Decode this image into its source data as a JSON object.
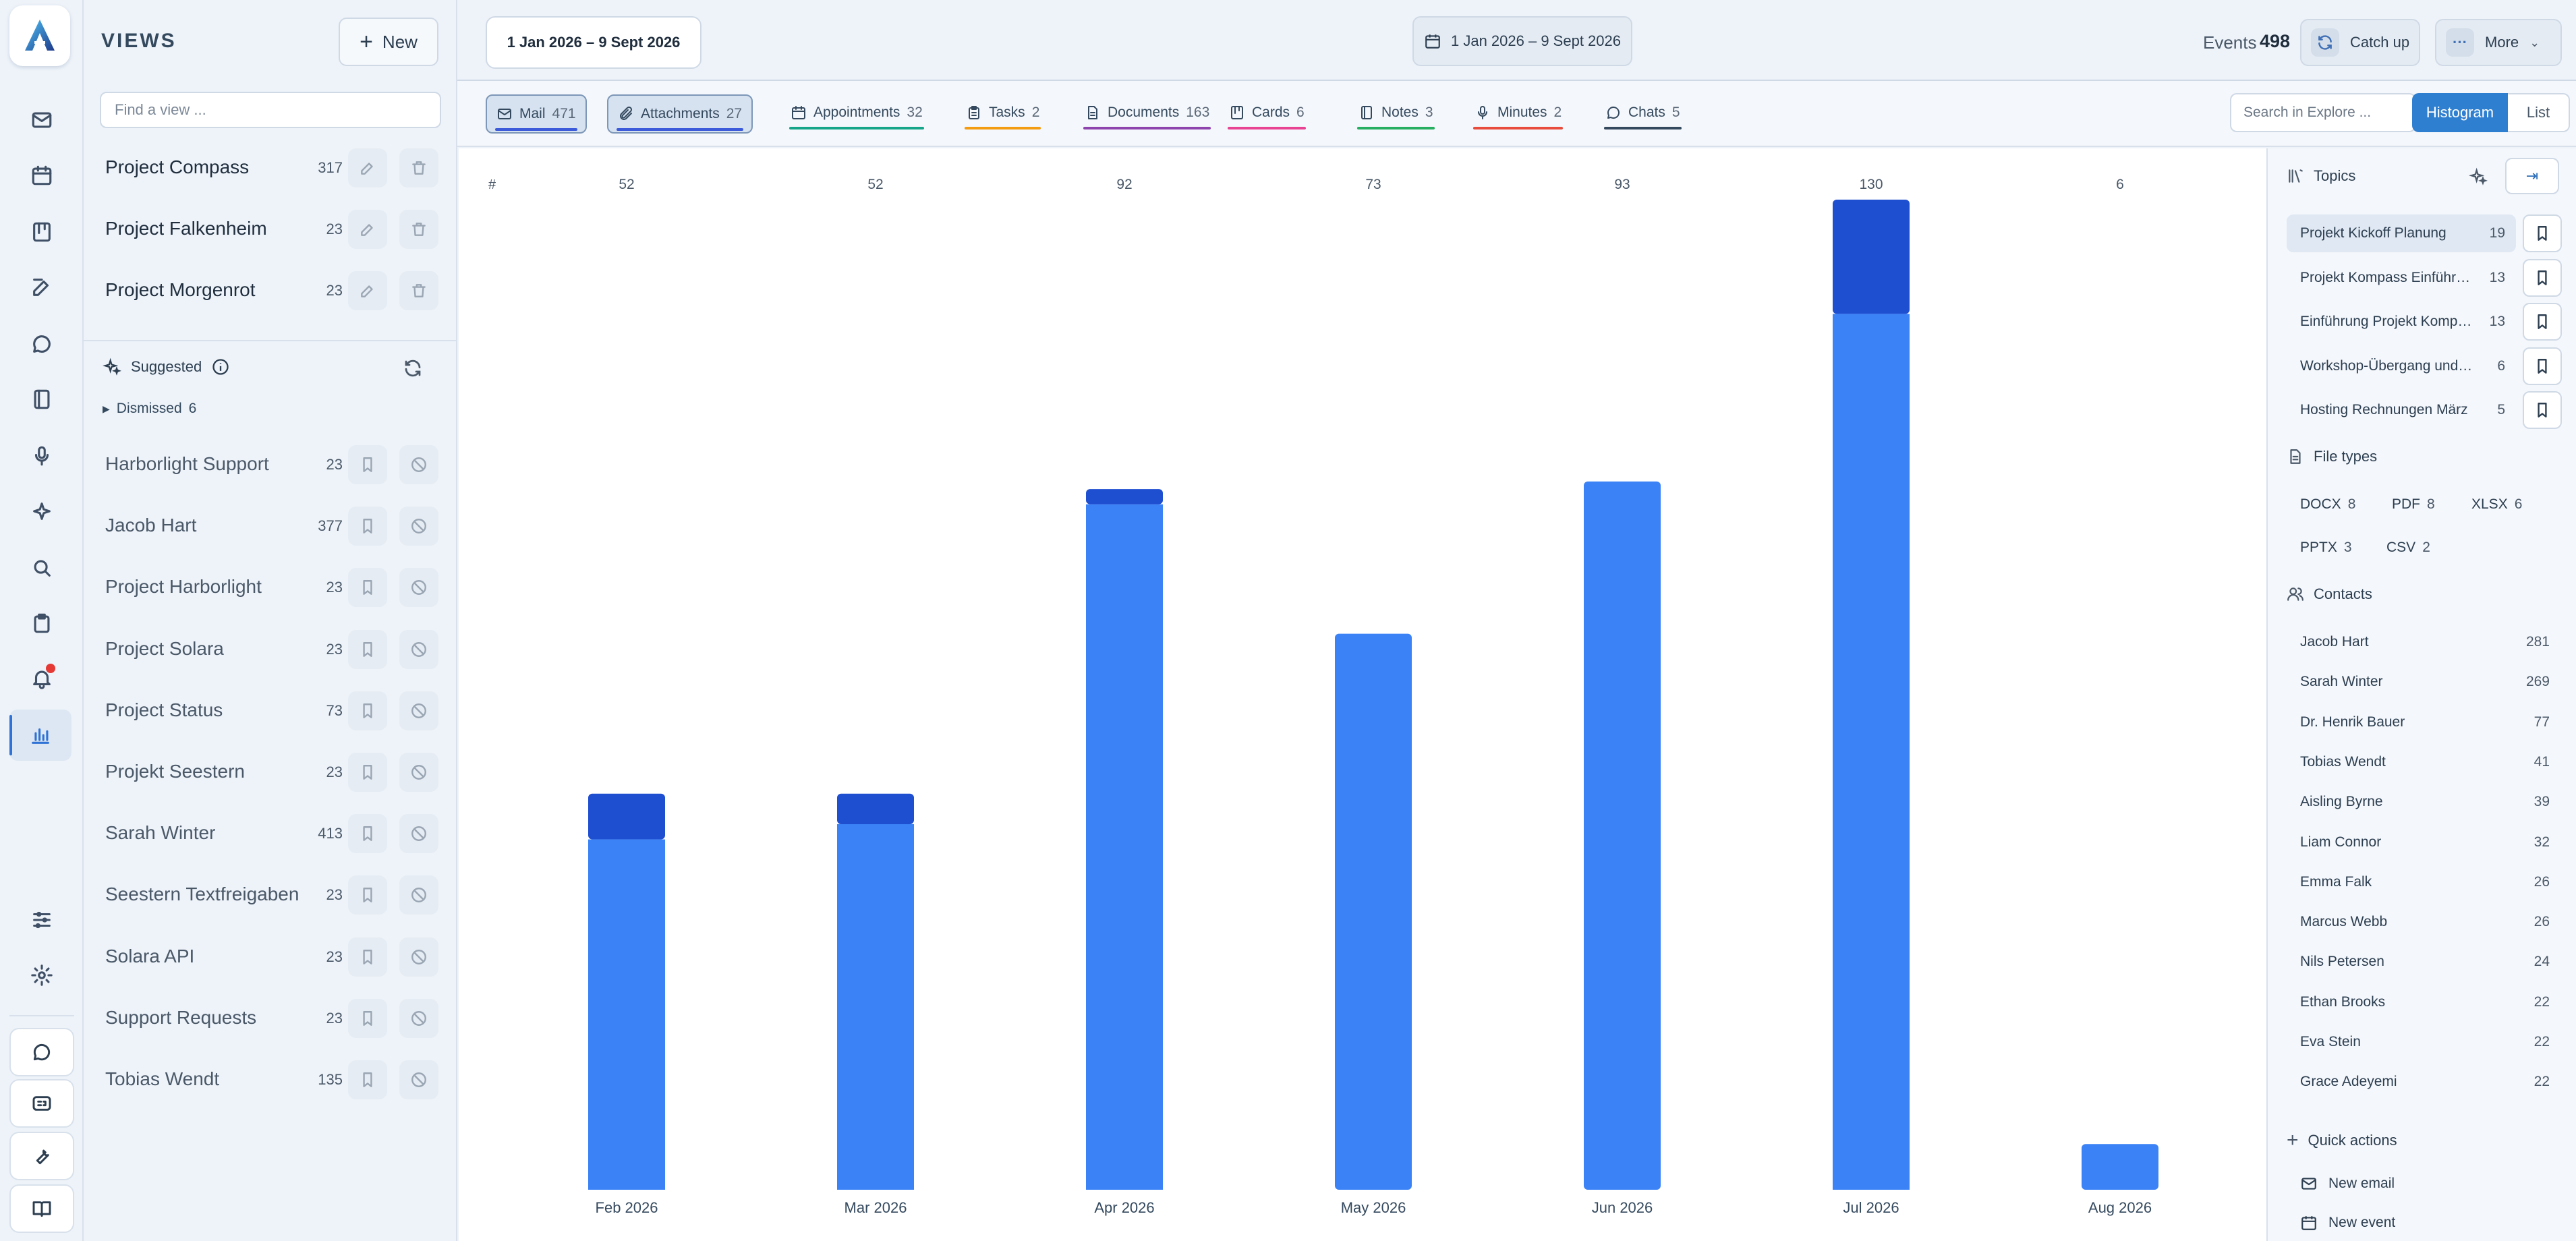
{
  "sidebar": {
    "title": "VIEWS",
    "new_label": "New",
    "find_placeholder": "Find a view ...",
    "views": [
      {
        "name": "Project Compass",
        "count": "317"
      },
      {
        "name": "Project Falkenheim",
        "count": "23"
      },
      {
        "name": "Project Morgenrot",
        "count": "23"
      }
    ],
    "suggested_label": "Suggested",
    "dismissed_label": "Dismissed",
    "dismissed_count": "6",
    "suggestions": [
      {
        "name": "Harborlight Support",
        "count": "23"
      },
      {
        "name": "Jacob Hart",
        "count": "377"
      },
      {
        "name": "Project Harborlight",
        "count": "23"
      },
      {
        "name": "Project Solara",
        "count": "23"
      },
      {
        "name": "Project Status",
        "count": "73"
      },
      {
        "name": "Projekt Seestern",
        "count": "23"
      },
      {
        "name": "Sarah Winter",
        "count": "413"
      },
      {
        "name": "Seestern Textfreigaben",
        "count": "23"
      },
      {
        "name": "Solara API",
        "count": "23"
      },
      {
        "name": "Support Requests",
        "count": "23"
      },
      {
        "name": "Tobias Wendt",
        "count": "135"
      }
    ]
  },
  "header": {
    "date_range_1": "1 Jan 2026 – 9 Sept 2026",
    "date_range_2": "1 Jan 2026 – 9 Sept 2026",
    "events_label": "Events",
    "events_count": "498",
    "catchup_label": "Catch up",
    "more_label": "More"
  },
  "filters": {
    "chips": [
      {
        "label": "Mail",
        "count": "471",
        "icon": "mail-icon",
        "color": "#3b5bdb"
      },
      {
        "label": "Attachments",
        "count": "27",
        "icon": "paperclip-icon",
        "color": "#3b5bdb"
      },
      {
        "label": "Appointments",
        "count": "32",
        "icon": "calendar-icon",
        "color": "#17a589"
      },
      {
        "label": "Tasks",
        "count": "2",
        "icon": "clipboard-icon",
        "color": "#f39c12"
      },
      {
        "label": "Documents",
        "count": "163",
        "icon": "document-icon",
        "color": "#8e44ad"
      },
      {
        "label": "Cards",
        "count": "6",
        "icon": "card-icon",
        "color": "#e84393"
      },
      {
        "label": "Notes",
        "count": "3",
        "icon": "notebook-icon",
        "color": "#27ae60"
      },
      {
        "label": "Minutes",
        "count": "2",
        "icon": "microphone-icon",
        "color": "#e74c3c"
      },
      {
        "label": "Chats",
        "count": "5",
        "icon": "chat-icon",
        "color": "#34495e"
      }
    ],
    "search_placeholder": "Search in Explore ...",
    "histogram_label": "Histogram",
    "list_label": "List"
  },
  "chart_data": {
    "type": "bar",
    "y_header": "#",
    "categories": [
      "Feb 2026",
      "Mar 2026",
      "Apr 2026",
      "May 2026",
      "Jun 2026",
      "Jul 2026",
      "Aug 2026"
    ],
    "totals": [
      52,
      52,
      92,
      73,
      93,
      130,
      6
    ],
    "series": [
      {
        "values": [
          46,
          48,
          90,
          73,
          93,
          115,
          6
        ],
        "color": "#3b82f6"
      },
      {
        "values": [
          6,
          4,
          2,
          0,
          0,
          15,
          0
        ],
        "color": "#1f4fd1"
      }
    ],
    "ylim": [
      0,
      130
    ]
  },
  "right_panel": {
    "topics_label": "Topics",
    "topics": [
      {
        "name": "Projekt Kickoff Planung",
        "count": "19"
      },
      {
        "name": "Projekt Kompass Einführung",
        "count": "13"
      },
      {
        "name": "Einführung Projekt Kompass",
        "count": "13"
      },
      {
        "name": "Workshop-Übergang und Abschluss",
        "count": "6"
      },
      {
        "name": "Hosting Rechnungen März",
        "count": "5"
      }
    ],
    "file_types_label": "File types",
    "file_types": [
      {
        "name": "DOCX",
        "count": "8"
      },
      {
        "name": "PDF",
        "count": "8"
      },
      {
        "name": "XLSX",
        "count": "6"
      },
      {
        "name": "PPTX",
        "count": "3"
      },
      {
        "name": "CSV",
        "count": "2"
      }
    ],
    "contacts_label": "Contacts",
    "contacts": [
      {
        "name": "Jacob Hart",
        "count": "281"
      },
      {
        "name": "Sarah Winter",
        "count": "269"
      },
      {
        "name": "Dr. Henrik Bauer",
        "count": "77"
      },
      {
        "name": "Tobias Wendt",
        "count": "41"
      },
      {
        "name": "Aisling Byrne",
        "count": "39"
      },
      {
        "name": "Liam Connor",
        "count": "32"
      },
      {
        "name": "Emma Falk",
        "count": "26"
      },
      {
        "name": "Marcus Webb",
        "count": "26"
      },
      {
        "name": "Nils Petersen",
        "count": "24"
      },
      {
        "name": "Ethan Brooks",
        "count": "22"
      },
      {
        "name": "Eva Stein",
        "count": "22"
      },
      {
        "name": "Grace Adeyemi",
        "count": "22"
      }
    ],
    "quick_actions_label": "Quick actions",
    "quick_actions": [
      {
        "label": "New email",
        "icon": "mail-icon"
      },
      {
        "label": "New event",
        "icon": "calendar-icon"
      }
    ]
  }
}
